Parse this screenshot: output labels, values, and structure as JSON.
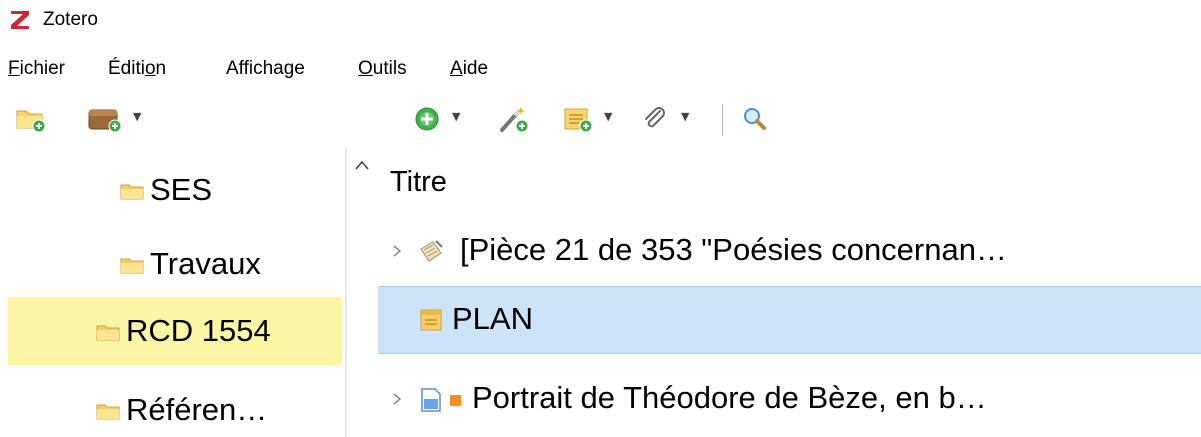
{
  "window": {
    "title": "Zotero"
  },
  "menu": {
    "items": [
      {
        "label": "Fichier",
        "accel": "F"
      },
      {
        "label": "Édition",
        "accel": "o"
      },
      {
        "label": "Affichage",
        "accel": ""
      },
      {
        "label": "Outils",
        "accel": "O"
      },
      {
        "label": "Aide",
        "accel": "A"
      }
    ]
  },
  "toolbar": {
    "buttons": [
      {
        "name": "new-collection",
        "icon": "folder-add-icon"
      },
      {
        "name": "new-library",
        "icon": "library-add-icon",
        "has_menu": true
      },
      {
        "name": "new-item",
        "icon": "plus-circle-icon",
        "has_menu": true
      },
      {
        "name": "add-by-identifier",
        "icon": "magic-wand-icon"
      },
      {
        "name": "new-note",
        "icon": "note-add-icon",
        "has_menu": true
      },
      {
        "name": "add-attachment",
        "icon": "paperclip-icon",
        "has_menu": true
      },
      {
        "name": "search",
        "icon": "magnifier-icon"
      }
    ]
  },
  "collections": [
    {
      "label": "SES",
      "selected": false
    },
    {
      "label": "Travaux",
      "selected": false
    },
    {
      "label": "RCD 1554",
      "selected": true
    },
    {
      "label": "Référen…",
      "selected": false
    }
  ],
  "items_pane": {
    "column_header": "Titre",
    "rows": [
      {
        "title": "[Pièce 21 de 353 \"Poésies concernan…",
        "icon": "manuscript-icon",
        "expandable": true,
        "selected": false,
        "tag_color": null
      },
      {
        "title": "PLAN",
        "icon": "note-icon",
        "expandable": false,
        "selected": true,
        "tag_color": null
      },
      {
        "title": "Portrait de Théodore de Bèze, en b…",
        "icon": "document-icon",
        "expandable": true,
        "selected": false,
        "tag_color": "#f38c21"
      }
    ]
  },
  "colors": {
    "selected_collection_bg": "#fbf6a6",
    "selected_item_bg": "#cde3f8",
    "brand_red": "#cc2936"
  }
}
